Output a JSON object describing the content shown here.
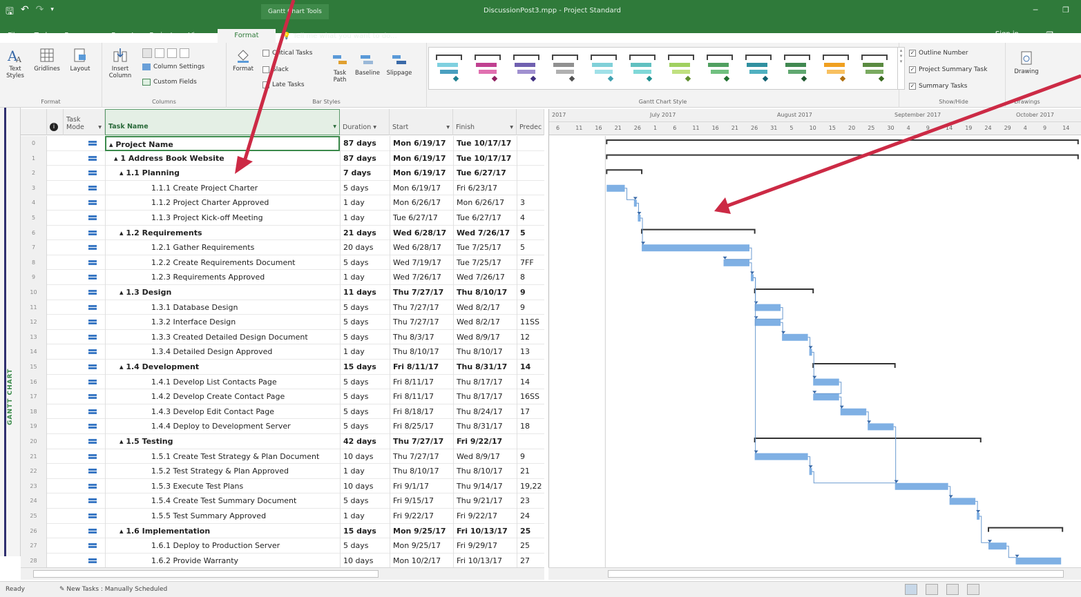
{
  "window": {
    "doc_title": "DiscussionPost3.mpp - Project Standard",
    "context_tab": "Gantt Chart Tools",
    "sign_in": "Sign in"
  },
  "tabs": [
    "File",
    "Task",
    "Resource",
    "Report",
    "Project",
    "View"
  ],
  "active_tab": "Format",
  "tell_me": "Tell me what you want to do...",
  "ribbon": {
    "format_group": {
      "label": "Format",
      "text_styles": "Text Styles",
      "gridlines": "Gridlines",
      "layout": "Layout"
    },
    "columns_group": {
      "label": "Columns",
      "insert_column": "Insert Column",
      "column_settings": "Column Settings",
      "custom_fields": "Custom Fields"
    },
    "bar_styles_group": {
      "label": "Bar Styles",
      "format": "Format",
      "critical_tasks": "Critical Tasks",
      "slack": "Slack",
      "late_tasks": "Late Tasks",
      "task_path": "Task Path",
      "baseline": "Baseline",
      "slippage": "Slippage"
    },
    "gantt_style_group": {
      "label": "Gantt Chart Style"
    },
    "show_hide_group": {
      "label": "Show/Hide",
      "outline_number": "Outline Number",
      "project_summary_task": "Project Summary Task",
      "summary_tasks": "Summary Tasks"
    },
    "drawings_group": {
      "label": "Drawings",
      "drawing": "Drawing"
    }
  },
  "gallery_colors": [
    [
      "#7fd0e0",
      "#4aa0c0",
      "#1f8090"
    ],
    [
      "#c04090",
      "#e070b0",
      "#902060"
    ],
    [
      "#7060b0",
      "#a090d0",
      "#403080"
    ],
    [
      "#909090",
      "#b0b0b0",
      "#505050"
    ],
    [
      "#80d0d8",
      "#a0e0e8",
      "#40a0b0"
    ],
    [
      "#60c0c0",
      "#80d8d8",
      "#209090"
    ],
    [
      "#a0d060",
      "#c0e080",
      "#609030"
    ],
    [
      "#50a060",
      "#70c080",
      "#207030"
    ],
    [
      "#3090a0",
      "#50b0c0",
      "#106070"
    ],
    [
      "#408850",
      "#60a870",
      "#205830"
    ],
    [
      "#f0a020",
      "#f8c060",
      "#b07010"
    ],
    [
      "#5a8a40",
      "#7aaa60",
      "#3a6a20"
    ]
  ],
  "view_label": "GANTT CHART",
  "columns": {
    "task_mode": "Task Mode",
    "task_name": "Task Name",
    "duration": "Duration",
    "start": "Start",
    "finish": "Finish",
    "predecessors": "Predec"
  },
  "timeline": {
    "top": [
      {
        "label": "2017"
      },
      {
        "label": "July 2017"
      },
      {
        "label": "August 2017"
      },
      {
        "label": "September 2017"
      },
      {
        "label": "October 2017"
      }
    ],
    "days": [
      "6",
      "11",
      "16",
      "21",
      "26",
      "1",
      "6",
      "11",
      "16",
      "21",
      "26",
      "31",
      "5",
      "10",
      "15",
      "20",
      "25",
      "30",
      "4",
      "9",
      "14",
      "19",
      "24",
      "29",
      "4",
      "9",
      "14"
    ]
  },
  "tasks": [
    {
      "id": "0",
      "name": "▴ Project Name",
      "duration": "87 days",
      "start": "Mon 6/19/17",
      "finish": "Tue 10/17/17",
      "pred": "",
      "bold": true,
      "indent": 0
    },
    {
      "id": "1",
      "name": "▴ 1 Address Book Website",
      "duration": "87 days",
      "start": "Mon 6/19/17",
      "finish": "Tue 10/17/17",
      "pred": "",
      "bold": true,
      "indent": 1
    },
    {
      "id": "2",
      "name": "▴ 1.1 Planning",
      "duration": "7 days",
      "start": "Mon 6/19/17",
      "finish": "Tue 6/27/17",
      "pred": "",
      "bold": true,
      "indent": 2
    },
    {
      "id": "3",
      "name": "1.1.1 Create Project Charter",
      "duration": "5 days",
      "start": "Mon 6/19/17",
      "finish": "Fri 6/23/17",
      "pred": "",
      "bold": false,
      "indent": 3
    },
    {
      "id": "4",
      "name": "1.1.2 Project Charter Approved",
      "duration": "1 day",
      "start": "Mon 6/26/17",
      "finish": "Mon 6/26/17",
      "pred": "3",
      "bold": false,
      "indent": 3
    },
    {
      "id": "5",
      "name": "1.1.3 Project Kick-off Meeting",
      "duration": "1 day",
      "start": "Tue 6/27/17",
      "finish": "Tue 6/27/17",
      "pred": "4",
      "bold": false,
      "indent": 3
    },
    {
      "id": "6",
      "name": "▴ 1.2 Requirements",
      "duration": "21 days",
      "start": "Wed 6/28/17",
      "finish": "Wed 7/26/17",
      "pred": "5",
      "bold": true,
      "indent": 2
    },
    {
      "id": "7",
      "name": "1.2.1 Gather Requirements",
      "duration": "20 days",
      "start": "Wed 6/28/17",
      "finish": "Tue 7/25/17",
      "pred": "5",
      "bold": false,
      "indent": 3
    },
    {
      "id": "8",
      "name": "1.2.2 Create Requirements Document",
      "duration": "5 days",
      "start": "Wed 7/19/17",
      "finish": "Tue 7/25/17",
      "pred": "7FF",
      "bold": false,
      "indent": 3
    },
    {
      "id": "9",
      "name": "1.2.3 Requirements Approved",
      "duration": "1 day",
      "start": "Wed 7/26/17",
      "finish": "Wed 7/26/17",
      "pred": "8",
      "bold": false,
      "indent": 3
    },
    {
      "id": "10",
      "name": "▴ 1.3 Design",
      "duration": "11 days",
      "start": "Thu 7/27/17",
      "finish": "Thu 8/10/17",
      "pred": "9",
      "bold": true,
      "indent": 2
    },
    {
      "id": "11",
      "name": "1.3.1 Database Design",
      "duration": "5 days",
      "start": "Thu 7/27/17",
      "finish": "Wed 8/2/17",
      "pred": "9",
      "bold": false,
      "indent": 3
    },
    {
      "id": "12",
      "name": "1.3.2 Interface Design",
      "duration": "5 days",
      "start": "Thu 7/27/17",
      "finish": "Wed 8/2/17",
      "pred": "11SS",
      "bold": false,
      "indent": 3
    },
    {
      "id": "13",
      "name": "1.3.3 Created Detailed Design Document",
      "duration": "5 days",
      "start": "Thu 8/3/17",
      "finish": "Wed 8/9/17",
      "pred": "12",
      "bold": false,
      "indent": 3
    },
    {
      "id": "14",
      "name": "1.3.4 Detailed Design Approved",
      "duration": "1 day",
      "start": "Thu 8/10/17",
      "finish": "Thu 8/10/17",
      "pred": "13",
      "bold": false,
      "indent": 3
    },
    {
      "id": "15",
      "name": "▴ 1.4 Development",
      "duration": "15 days",
      "start": "Fri 8/11/17",
      "finish": "Thu 8/31/17",
      "pred": "14",
      "bold": true,
      "indent": 2
    },
    {
      "id": "16",
      "name": "1.4.1 Develop List Contacts Page",
      "duration": "5 days",
      "start": "Fri 8/11/17",
      "finish": "Thu 8/17/17",
      "pred": "14",
      "bold": false,
      "indent": 3
    },
    {
      "id": "17",
      "name": "1.4.2 Develop Create Contact Page",
      "duration": "5 days",
      "start": "Fri 8/11/17",
      "finish": "Thu 8/17/17",
      "pred": "16SS",
      "bold": false,
      "indent": 3
    },
    {
      "id": "18",
      "name": "1.4.3 Develop Edit Contact Page",
      "duration": "5 days",
      "start": "Fri 8/18/17",
      "finish": "Thu 8/24/17",
      "pred": "17",
      "bold": false,
      "indent": 3
    },
    {
      "id": "19",
      "name": "1.4.4 Deploy to Development Server",
      "duration": "5 days",
      "start": "Fri 8/25/17",
      "finish": "Thu 8/31/17",
      "pred": "18",
      "bold": false,
      "indent": 3
    },
    {
      "id": "20",
      "name": "▴ 1.5 Testing",
      "duration": "42 days",
      "start": "Thu 7/27/17",
      "finish": "Fri 9/22/17",
      "pred": "",
      "bold": true,
      "indent": 2
    },
    {
      "id": "21",
      "name": "1.5.1 Create Test Strategy & Plan Document",
      "duration": "10 days",
      "start": "Thu 7/27/17",
      "finish": "Wed 8/9/17",
      "pred": "9",
      "bold": false,
      "indent": 3
    },
    {
      "id": "22",
      "name": "1.5.2 Test Strategy & Plan Approved",
      "duration": "1 day",
      "start": "Thu 8/10/17",
      "finish": "Thu 8/10/17",
      "pred": "21",
      "bold": false,
      "indent": 3
    },
    {
      "id": "23",
      "name": "1.5.3 Execute Test Plans",
      "duration": "10 days",
      "start": "Fri 9/1/17",
      "finish": "Thu 9/14/17",
      "pred": "19,22",
      "bold": false,
      "indent": 3
    },
    {
      "id": "24",
      "name": "1.5.4 Create Test Summary Document",
      "duration": "5 days",
      "start": "Fri 9/15/17",
      "finish": "Thu 9/21/17",
      "pred": "23",
      "bold": false,
      "indent": 3
    },
    {
      "id": "25",
      "name": "1.5.5 Test Summary Approved",
      "duration": "1 day",
      "start": "Fri 9/22/17",
      "finish": "Fri 9/22/17",
      "pred": "24",
      "bold": false,
      "indent": 3
    },
    {
      "id": "26",
      "name": "▴ 1.6 Implementation",
      "duration": "15 days",
      "start": "Mon 9/25/17",
      "finish": "Fri 10/13/17",
      "pred": "25",
      "bold": true,
      "indent": 2
    },
    {
      "id": "27",
      "name": "1.6.1 Deploy to Production Server",
      "duration": "5 days",
      "start": "Mon 9/25/17",
      "finish": "Fri 9/29/17",
      "pred": "25",
      "bold": false,
      "indent": 3
    },
    {
      "id": "28",
      "name": "1.6.2 Provide Warranty",
      "duration": "10 days",
      "start": "Mon 10/2/17",
      "finish": "Fri 10/13/17",
      "pred": "27",
      "bold": false,
      "indent": 3
    }
  ],
  "status": {
    "ready": "Ready",
    "new_tasks": "New Tasks : Manually Scheduled"
  },
  "colors": {
    "title_green": "#2f7a3a",
    "bar_blue": "#7fb0e4",
    "summary_black": "#333333",
    "annotation_red": "#cc2a45"
  }
}
